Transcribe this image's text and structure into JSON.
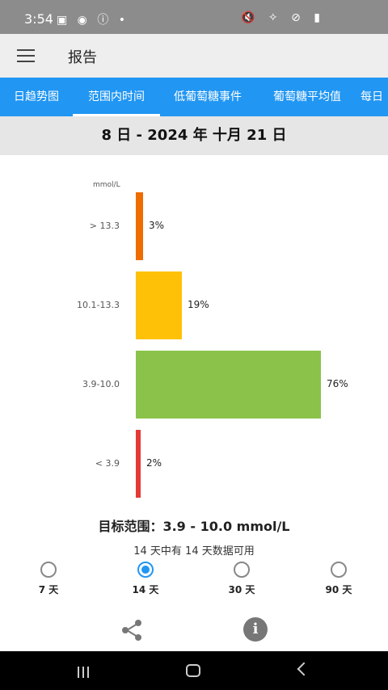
{
  "status_bar": {
    "time": "3:54",
    "left_icons": "▣ ◉ ⓘ •",
    "right_icons": "🔇 ✧ ⊘ ▮"
  },
  "app_bar": {
    "title": "报告"
  },
  "tabs": [
    {
      "label": "日趋势图"
    },
    {
      "label": "范围内时间"
    },
    {
      "label": "低葡萄糖事件"
    },
    {
      "label": "葡萄糖平均值"
    },
    {
      "label": "每日"
    }
  ],
  "date_range": "8 日 - 2024 年 十月 21 日",
  "chart_data": {
    "type": "bar",
    "orientation": "horizontal",
    "unit_label": "mmol/L",
    "categories": [
      "> 13.3",
      "10.1-13.3",
      "3.9-10.0",
      "< 3.9"
    ],
    "values": [
      3,
      19,
      76,
      2
    ],
    "value_labels": [
      "3%",
      "19%",
      "76%",
      "2%"
    ],
    "colors": [
      "#ef6c00",
      "#ffc107",
      "#8bc34a",
      "#e53935"
    ]
  },
  "target_range": "目标范围：3.9 - 10.0 mmol/L",
  "data_availability": "14 天中有 14 天数据可用",
  "period_options": [
    {
      "label": "7 天",
      "selected": false
    },
    {
      "label": "14 天",
      "selected": true
    },
    {
      "label": "30 天",
      "selected": false
    },
    {
      "label": "90 天",
      "selected": false
    }
  ],
  "accent_color": "#2196f3"
}
